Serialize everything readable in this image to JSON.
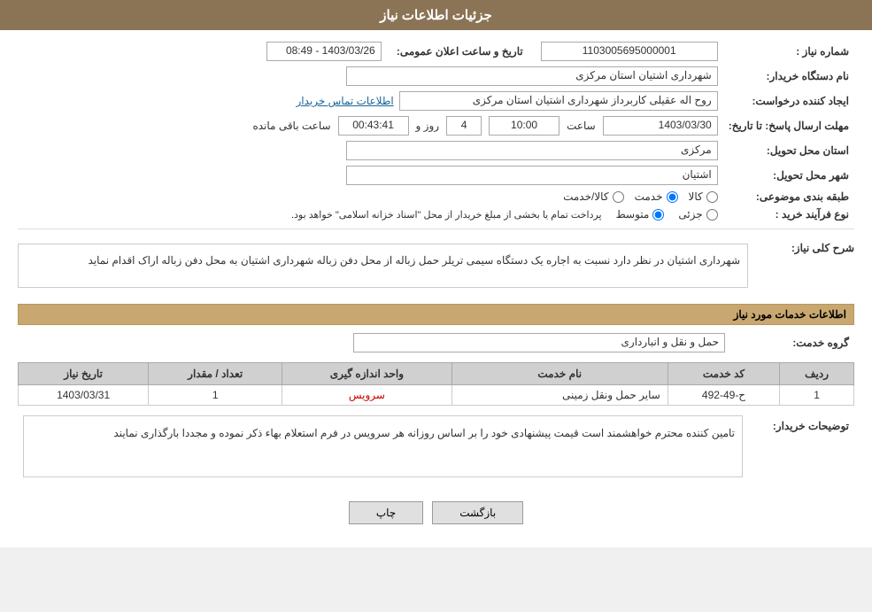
{
  "header": {
    "title": "جزئیات اطلاعات نیاز"
  },
  "fields": {
    "need_number_label": "شماره نیاز :",
    "need_number_value": "1103005695000001",
    "buyer_name_label": "نام دستگاه خریدار:",
    "buyer_name_value": "شهرداری اشتیان استان مرکزی",
    "creator_label": "ایجاد کننده درخواست:",
    "creator_value": "روح اله عقیلی کاربرداز شهرداری اشتیان استان مرکزی",
    "contact_link": "اطلاعات تماس خریدار",
    "deadline_label": "مهلت ارسال پاسخ: تا تاریخ:",
    "deadline_date": "1403/03/30",
    "deadline_time_label": "ساعت",
    "deadline_time_value": "10:00",
    "deadline_days_label": "روز و",
    "deadline_days_value": "4",
    "deadline_remaining_label": "ساعت باقی مانده",
    "deadline_remaining_value": "00:43:41",
    "announce_label": "تاریخ و ساعت اعلان عمومی:",
    "announce_value": "1403/03/26 - 08:49",
    "province_label": "استان محل تحویل:",
    "province_value": "مرکزی",
    "city_label": "شهر محل تحویل:",
    "city_value": "اشتیان",
    "category_label": "طبقه بندی موضوعی:",
    "category_options": [
      "کالا",
      "خدمت",
      "کالا/خدمت"
    ],
    "category_selected": "خدمت",
    "process_label": "نوع فرآیند خرید :",
    "process_options": [
      "جزئی",
      "متوسط"
    ],
    "process_note": "پرداخت تمام یا بخشی از مبلغ خریدار از محل \"اسناد خزانه اسلامی\" خواهد بود."
  },
  "description": {
    "section_label": "شرح کلی نیاز:",
    "text": "شهرداری اشتیان در نظر دارد نسبت به اجاره یک دستگاه سیمی تریلر حمل زباله از محل دفن زباله شهرداری اشتیان به محل دفن زباله اراک اقدام نماید"
  },
  "service_info": {
    "section_label": "اطلاعات خدمات مورد نیاز",
    "group_label": "گروه خدمت:",
    "group_value": "حمل و نقل و انبارداری",
    "table_headers": [
      "ردیف",
      "کد خدمت",
      "نام خدمت",
      "واحد اندازه گیری",
      "تعداد / مقدار",
      "تاریخ نیاز"
    ],
    "table_rows": [
      {
        "row": "1",
        "code": "ح-49-492",
        "name": "سایر حمل ونقل زمینی",
        "unit": "سرویس",
        "quantity": "1",
        "date": "1403/03/31"
      }
    ]
  },
  "buyer_notes": {
    "label": "توضیحات خریدار:",
    "text": "تامین کننده محترم خواهشمند است قیمت پیشنهادی خود را بر اساس روزانه هر سرویس در فرم استعلام بهاء ذکر نموده و مجددا بارگذاری نمایند"
  },
  "buttons": {
    "print": "چاپ",
    "back": "بازگشت"
  }
}
